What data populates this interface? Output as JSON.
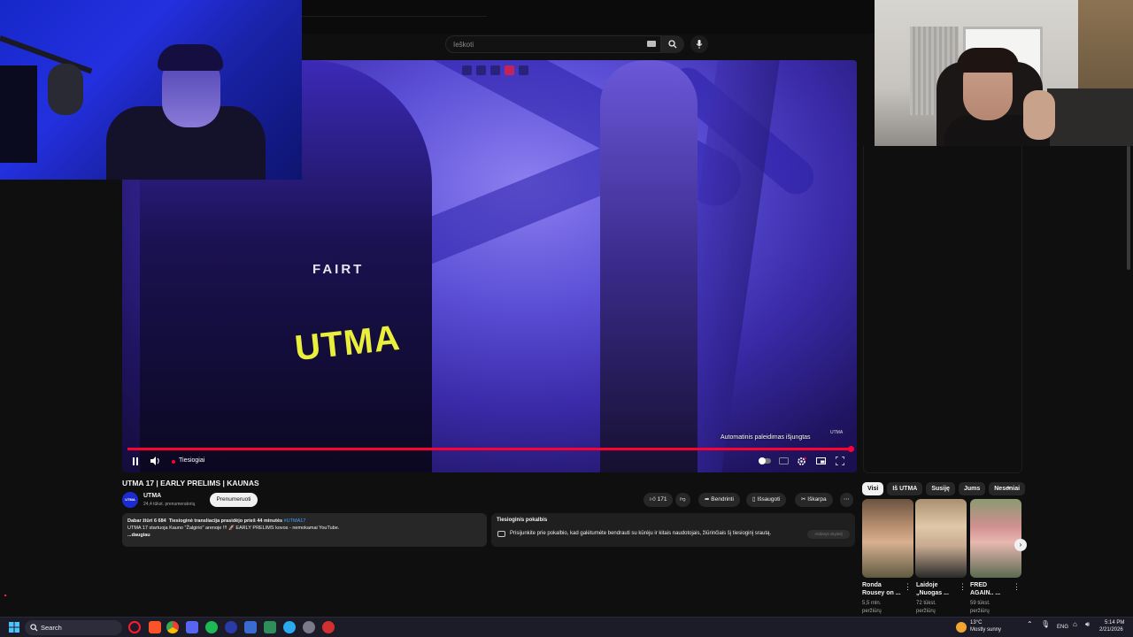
{
  "search": {
    "placeholder": "Ieškoti"
  },
  "player": {
    "autoplay_tooltip": "Automatinis paleidimas išjungtas",
    "live_label": "Tiesiogiai",
    "watermark": "UTMA",
    "progress_percent": 100
  },
  "video": {
    "title": "UTMA 17 | EARLY PRELIMS | KAUNAS",
    "channel_name": "UTMA",
    "channel_avatar_text": "UTMA",
    "subscribers": "24,4 tūkst. prenumeratorių",
    "subscribe_label": "Prenumeruoti",
    "likes": "171",
    "share_label": "Bendrinti",
    "save_label": "Išsaugoti",
    "clip_label": "Iškarpa"
  },
  "description": {
    "watching": "Dabar žiūri 6 684",
    "started": "Tiesioginė transliacija prasidėjo prieš 44 minutės",
    "hashtag": "#UTMA17",
    "line2": "UTMA 17 startuoja Kauno \"Žalgirio\" arenoje !!! 🚀 EARLY PRELIMS kovos - nemokamai YouTube.",
    "more": "...daugiau"
  },
  "live_chat": {
    "title": "Tiesioginis pokalbis",
    "message": "Prisijunkite prie pokalbio, kad galėtumėte bendrauti su kūrėju ir kitais naudotojais, žiūrinčiais šį tiesioginį srautą.",
    "button": "Atidaryti skydelį"
  },
  "sidebar": {
    "chips": [
      "Visi",
      "Iš UTMA",
      "Susiję",
      "Jums",
      "Neseniai"
    ],
    "videos": [
      {
        "title": "Ronda Rousey on ...",
        "meta1": "5,5 mln.",
        "meta2": "peržiūrų"
      },
      {
        "title": "Laidoje „Nuogas ...",
        "meta1": "72 tūkst.",
        "meta2": "peržiūrų"
      },
      {
        "title": "FRED AGAIN.. ...",
        "meta1": "59 tūkst.",
        "meta2": "peržiūrų"
      }
    ]
  },
  "video_overlay_text": {
    "fairtex": "FAIRT",
    "utma_shorts": "UTMA"
  },
  "taskbar": {
    "search_label": "Search",
    "weather_temp": "13°C",
    "weather_desc": "Mostly sunny",
    "language": "ENG",
    "time": "5:14 PM",
    "date": "2/21/2026"
  },
  "colors": {
    "accent_red": "#ff0033",
    "background": "#0f0f0f",
    "link_blue": "#3ea6ff"
  }
}
